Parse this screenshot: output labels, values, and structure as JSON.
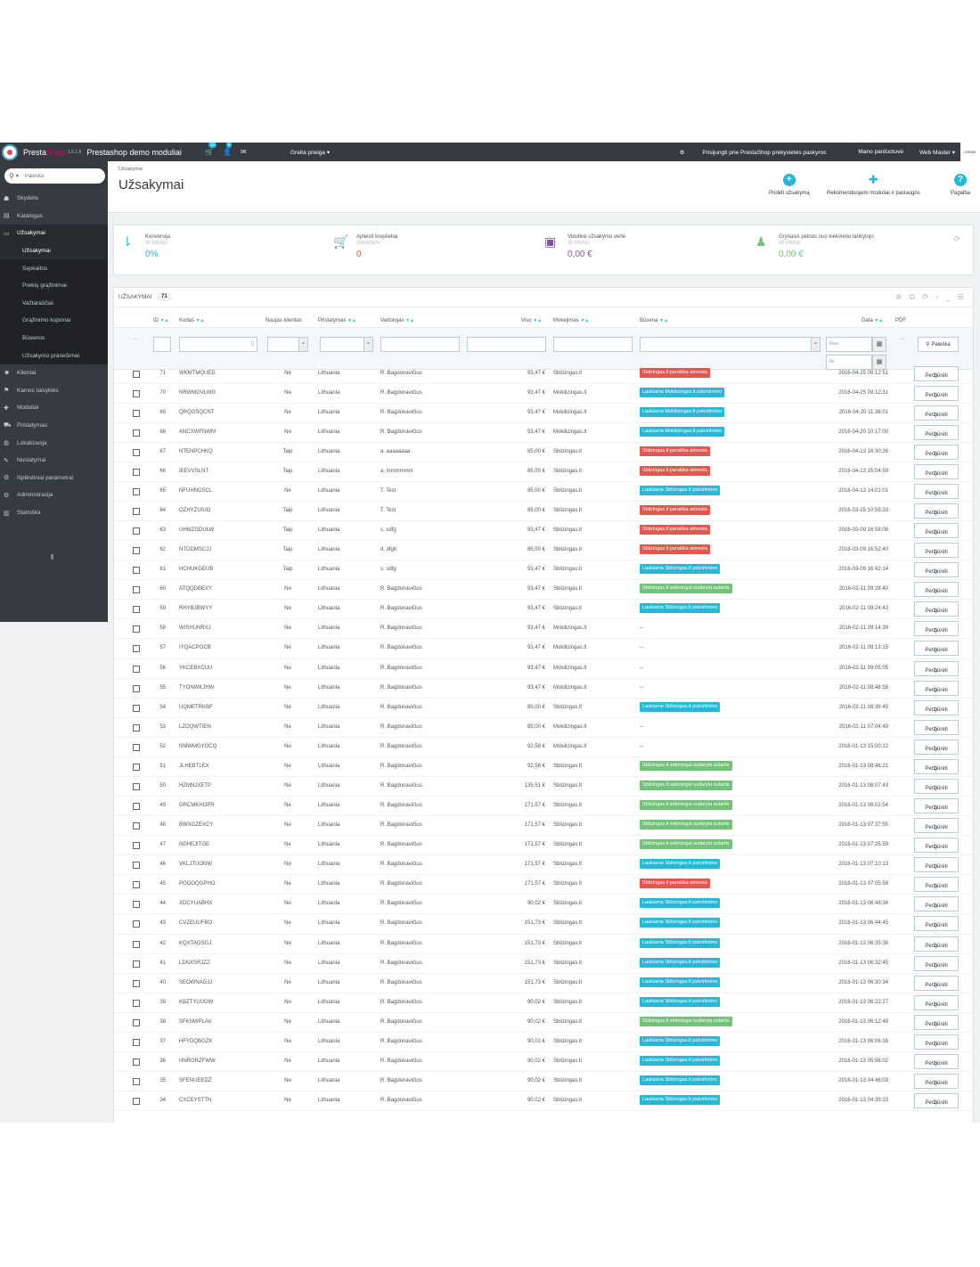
{
  "header": {
    "brand_a": "Presta",
    "brand_b": "Shop",
    "version": "1.6.1.5",
    "shop_name": "Prestashop demo moduliai",
    "orders_badge": "15",
    "customers_badge": "6",
    "quick_access": "Greita prieiga ▾",
    "connect": "Prisijungti prie PrestaShop prekyvietės paskyros",
    "my_shop": "Mano parduotuvė",
    "user": "Web Master ▾",
    "mini_logo": "CRMW"
  },
  "sidebar": {
    "search_placeholder": "Paieška",
    "items": [
      {
        "icon": "dashboard-icon",
        "glyph": "☗",
        "label": "Skydelis"
      },
      {
        "icon": "catalog-icon",
        "glyph": "▤",
        "label": "Katalogas"
      },
      {
        "icon": "orders-icon",
        "glyph": "▭",
        "label": "Užsakymai"
      },
      {
        "icon": "customers-icon",
        "glyph": "☻",
        "label": "Klientai"
      },
      {
        "icon": "price-rules-icon",
        "glyph": "⚑",
        "label": "Kainos taisyklės"
      },
      {
        "icon": "modules-icon",
        "glyph": "✚",
        "label": "Moduliai"
      },
      {
        "icon": "shipping-icon",
        "glyph": "⛟",
        "label": "Pristatymas"
      },
      {
        "icon": "localization-icon",
        "glyph": "◍",
        "label": "Lokalizacija"
      },
      {
        "icon": "settings-icon",
        "glyph": "✎",
        "label": "Nustatymai"
      },
      {
        "icon": "advanced-icon",
        "glyph": "⚙",
        "label": "Išplėstiniai parametrai"
      },
      {
        "icon": "admin-icon",
        "glyph": "⚙",
        "label": "Administracija"
      },
      {
        "icon": "stats-icon",
        "glyph": "▥",
        "label": "Statistika"
      }
    ],
    "subitems": [
      "Užsakymai",
      "Sąskaitos",
      "Prekių grąžinimai",
      "Važtaraščiai",
      "Grąžinimo kuponai",
      "Būsenos",
      "Užsakymo pranešimai"
    ]
  },
  "page": {
    "breadcrumb": "Užsakymai",
    "title": "Užsakymai",
    "tools": [
      {
        "label": "Pridėti užsakymą",
        "glyph": "+"
      },
      {
        "label": "Rekomenduojami moduliai ir paslaugos",
        "glyph": "✚"
      },
      {
        "label": "Pagalba",
        "glyph": "?"
      }
    ]
  },
  "kpis": [
    {
      "label": "Konversija",
      "sub": "30 DIENŲ",
      "value": "0%",
      "color": "#25b9d7",
      "glyph": "⇂"
    },
    {
      "label": "Apleisti krepšeliai",
      "sub": "ŠIANDIEN",
      "value": "0",
      "color": "#e0584f",
      "glyph": "🛒"
    },
    {
      "label": "Vidutinė užsakymo vertė",
      "sub": "30 DIENŲ",
      "value": "0,00 €",
      "color": "#7e55a3",
      "glyph": "▣"
    },
    {
      "label": "Grynasis pelnas nuo kiekvieno lankytojo",
      "sub": "30 DIENŲ",
      "value": "0,00 €",
      "color": "#72c279",
      "glyph": "♟"
    }
  ],
  "orders": {
    "title": "UŽSAKYMAI",
    "count": "71",
    "columns": {
      "id": "ID",
      "ref": "Kodas",
      "new": "Naujas klientas",
      "delivery": "Pristatymas",
      "customer": "Vartotojas",
      "total": "Viso",
      "payment": "Mokėjimas",
      "status": "Būsena",
      "date": "Data",
      "pdf": "PDF"
    },
    "filter": {
      "select_placeholder": "-",
      "date_from": "Nuo",
      "date_to": "Iki",
      "search_label": "Paieška"
    },
    "view_label": "Peržiūrėti",
    "rows": [
      {
        "id": "71",
        "ref": "WKMTMQUED",
        "new": "Ne",
        "delivery": "Lithuania",
        "customer": "R. Bagdonavičius",
        "total": "93,47 €",
        "payment": "Sblizingas.lt",
        "status": "Sblizingas.lt paraiška atmesta",
        "status_color": "#e0584f",
        "date": "2016-04-25 09:12:51"
      },
      {
        "id": "70",
        "ref": "NRWMGVLWG",
        "new": "Ne",
        "delivery": "Lithuania",
        "customer": "R. Bagdonavičius",
        "total": "93,47 €",
        "payment": "Mokilizingas.lt",
        "status": "Laukiama Mokilizingas.lt patvirtinimo",
        "status_color": "#25b9d7",
        "date": "2016-04-25 09:12:31"
      },
      {
        "id": "69",
        "ref": "QRQGSQCNT",
        "new": "Ne",
        "delivery": "Lithuania",
        "customer": "R. Bagdonavičius",
        "total": "93,47 €",
        "payment": "Mokilizingas.lt",
        "status": "Laukiama Mokilizingas.lt patvirtinimo",
        "status_color": "#25b9d7",
        "date": "2016-04-20 11:36:01"
      },
      {
        "id": "68",
        "ref": "ANCXWFNWM",
        "new": "Ne",
        "delivery": "Lithuania",
        "customer": "R. Bagdonavičius",
        "total": "93,47 €",
        "payment": "Mokilizingas.lt",
        "status": "Laukiama Mokilizingas.lt patvirtinimo",
        "status_color": "#25b9d7",
        "date": "2016-04-20 10:17:00"
      },
      {
        "id": "67",
        "ref": "NTENPCHKQ",
        "new": "Taip",
        "delivery": "Lithuania",
        "customer": "a. aaaaaaaa",
        "total": "85,00 €",
        "payment": "Sblizingas.lt",
        "status": "Sblizingas.lt paraiška atmesta",
        "status_color": "#e0584f",
        "date": "2016-04-13 16:30:26"
      },
      {
        "id": "66",
        "ref": "IEEVVSLNT",
        "new": "Taip",
        "delivery": "Lithuania",
        "customer": "a. mmmmmm",
        "total": "85,00 €",
        "payment": "Sblizingas.lt",
        "status": "Sblizingas.lt paraiška atmesta",
        "status_color": "#e0584f",
        "date": "2016-04-13 15:04:59"
      },
      {
        "id": "65",
        "ref": "NFUHNGSCL",
        "new": "Ne",
        "delivery": "Lithuania",
        "customer": "T. Test",
        "total": "85,00 €",
        "payment": "Sblizingas.lt",
        "status": "Laukiama Sblizingas.lt patvirtinimo",
        "status_color": "#25b9d7",
        "date": "2016-04-13 14:01:01"
      },
      {
        "id": "64",
        "ref": "OZHYZUIUO",
        "new": "Taip",
        "delivery": "Lithuania",
        "customer": "T. Test",
        "total": "85,00 €",
        "payment": "Sblizingas.lt",
        "status": "Sblizingas.lt paraiška atmesta",
        "status_color": "#e0584f",
        "date": "2016-03-25 10:59:33"
      },
      {
        "id": "63",
        "ref": "UHMZGDULW",
        "new": "Taip",
        "delivery": "Lithuania",
        "customer": "s. sdfg",
        "total": "93,47 €",
        "payment": "Sblizingas.lt",
        "status": "Sblizingas.lt paraiška atmesta",
        "status_color": "#e0584f",
        "date": "2016-03-09 16:58:08"
      },
      {
        "id": "62",
        "ref": "NTODMSCJJ",
        "new": "Taip",
        "delivery": "Lithuania",
        "customer": "d. dfgh",
        "total": "85,00 €",
        "payment": "Sblizingas.lt",
        "status": "Sblizingas.lt paraiška atmesta",
        "status_color": "#e0584f",
        "date": "2016-03-09 16:52:40"
      },
      {
        "id": "61",
        "ref": "HCHUKGEUB",
        "new": "Taip",
        "delivery": "Lithuania",
        "customer": "s. sdfg",
        "total": "93,47 €",
        "payment": "Sblizingas.lt",
        "status": "Laukiama Sblizingas.lt patvirtinimo",
        "status_color": "#25b9d7",
        "date": "2016-03-09 16:42:14"
      },
      {
        "id": "60",
        "ref": "ATQQDBEXY",
        "new": "Ne",
        "delivery": "Lithuania",
        "customer": "R. Bagdonavičius",
        "total": "93,47 €",
        "payment": "Sblizingas.lt",
        "status": "Sblizingas.lt sėkmingai sudaryta sutartis",
        "status_color": "#72c279",
        "date": "2016-02-11 09:28:40"
      },
      {
        "id": "59",
        "ref": "RHYBJBWYY",
        "new": "Ne",
        "delivery": "Lithuania",
        "customer": "R. Bagdonavičius",
        "total": "93,47 €",
        "payment": "Sblizingas.lt",
        "status": "Laukiama Sblizingas.lt patvirtinimo",
        "status_color": "#25b9d7",
        "date": "2016-02-11 09:24:43"
      },
      {
        "id": "58",
        "ref": "WISHUNRXJ",
        "new": "Ne",
        "delivery": "Lithuania",
        "customer": "R. Bagdonavičius",
        "total": "93,47 €",
        "payment": "Mokilizingas.lt",
        "status": "--",
        "status_color": "",
        "date": "2016-02-11 09:14:39"
      },
      {
        "id": "57",
        "ref": "IYQACPGCB",
        "new": "Ne",
        "delivery": "Lithuania",
        "customer": "R. Bagdonavičius",
        "total": "93,47 €",
        "payment": "Mokilizingas.lt",
        "status": "--",
        "status_color": "",
        "date": "2016-02-11 09:13:15"
      },
      {
        "id": "56",
        "ref": "YKCEBXCUU",
        "new": "Ne",
        "delivery": "Lithuania",
        "customer": "R. Bagdonavičius",
        "total": "93,47 €",
        "payment": "Mokilizingas.lt",
        "status": "--",
        "status_color": "",
        "date": "2016-02-11 09:05:05"
      },
      {
        "id": "55",
        "ref": "TYONWKJHW",
        "new": "Ne",
        "delivery": "Lithuania",
        "customer": "R. Bagdonavičius",
        "total": "93,47 €",
        "payment": "Mokilizingas.lt",
        "status": "--",
        "status_color": "",
        "date": "2016-02-11 08:48:58"
      },
      {
        "id": "54",
        "ref": "UQMETRKBF",
        "new": "Ne",
        "delivery": "Lithuania",
        "customer": "R. Bagdonavičius",
        "total": "85,00 €",
        "payment": "Sblizingas.lt",
        "status": "Laukiama Sblizingas.lt patvirtinimo",
        "status_color": "#25b9d7",
        "date": "2016-02-11 08:39:45"
      },
      {
        "id": "53",
        "ref": "LZOQWTIEN",
        "new": "Ne",
        "delivery": "Lithuania",
        "customer": "R. Bagdonavičius",
        "total": "85,00 €",
        "payment": "Mokilizingas.lt",
        "status": "--",
        "status_color": "",
        "date": "2016-02-11 07:04:49"
      },
      {
        "id": "52",
        "ref": "NMWMGYOCQ",
        "new": "Ne",
        "delivery": "Lithuania",
        "customer": "R. Bagdonavičius",
        "total": "92,58 €",
        "payment": "Mokilizingas.lt",
        "status": "--",
        "status_color": "",
        "date": "2016-01-13 15:00:22"
      },
      {
        "id": "51",
        "ref": "JLHEBTLEX",
        "new": "Ne",
        "delivery": "Lithuania",
        "customer": "R. Bagdonavičius",
        "total": "92,58 €",
        "payment": "Sblizingas.lt",
        "status": "Sblizingas.lt sėkmingai sudaryta sutartis",
        "status_color": "#72c279",
        "date": "2016-01-13 08:46:21"
      },
      {
        "id": "50",
        "ref": "HZMNJXETP",
        "new": "Ne",
        "delivery": "Lithuania",
        "customer": "R. Bagdonavičius",
        "total": "135,51 €",
        "payment": "Sblizingas.lt",
        "status": "Sblizingas.lt sėkmingai sudaryta sutartis",
        "status_color": "#72c279",
        "date": "2016-01-13 08:07:43"
      },
      {
        "id": "49",
        "ref": "GRCMKHOPR",
        "new": "Ne",
        "delivery": "Lithuania",
        "customer": "R. Bagdonavičius",
        "total": "171,57 €",
        "payment": "Sblizingas.lt",
        "status": "Sblizingas.lt sėkmingai sudaryta sutartis",
        "status_color": "#72c279",
        "date": "2016-01-13 08:02:54"
      },
      {
        "id": "48",
        "ref": "BWXGZEXCY",
        "new": "Ne",
        "delivery": "Lithuania",
        "customer": "R. Bagdonavičius",
        "total": "171,57 €",
        "payment": "Sblizingas.lt",
        "status": "Sblizingas.lt sėkmingai sudaryta sutartis",
        "status_color": "#72c279",
        "date": "2016-01-13 07:37:55"
      },
      {
        "id": "47",
        "ref": "NDHEJITGE",
        "new": "Ne",
        "delivery": "Lithuania",
        "customer": "R. Bagdonavičius",
        "total": "171,57 €",
        "payment": "Sblizingas.lt",
        "status": "Sblizingas.lt sėkmingai sudaryta sutartis",
        "status_color": "#72c279",
        "date": "2016-01-13 07:25:59"
      },
      {
        "id": "46",
        "ref": "VKLJTUONW",
        "new": "Ne",
        "delivery": "Lithuania",
        "customer": "R. Bagdonavičius",
        "total": "171,57 €",
        "payment": "Sblizingas.lt",
        "status": "Laukiama Sblizingas.lt patvirtinimo",
        "status_color": "#25b9d7",
        "date": "2016-01-13 07:10:13"
      },
      {
        "id": "45",
        "ref": "PGOOQGPHO",
        "new": "Ne",
        "delivery": "Lithuania",
        "customer": "R. Bagdonavičius",
        "total": "171,57 €",
        "payment": "Sblizingas.lt",
        "status": "Sblizingas.lt paraiška atmesta",
        "status_color": "#e0584f",
        "date": "2016-01-13 07:05:58"
      },
      {
        "id": "44",
        "ref": "XDCYUABHX",
        "new": "Ne",
        "delivery": "Lithuania",
        "customer": "R. Bagdonavičius",
        "total": "90,02 €",
        "payment": "Sblizingas.lt",
        "status": "Laukiama Sblizingas.lt patvirtinimo",
        "status_color": "#25b9d7",
        "date": "2016-01-13 06:48:34"
      },
      {
        "id": "43",
        "ref": "CVZEUUFBO",
        "new": "Ne",
        "delivery": "Lithuania",
        "customer": "R. Bagdonavičius",
        "total": "151,73 €",
        "payment": "Sblizingas.lt",
        "status": "Laukiama Sblizingas.lt patvirtinimo",
        "status_color": "#25b9d7",
        "date": "2016-01-13 06:44:45"
      },
      {
        "id": "42",
        "ref": "KQXTAGSGJ",
        "new": "Ne",
        "delivery": "Lithuania",
        "customer": "R. Bagdonavičius",
        "total": "151,73 €",
        "payment": "Sblizingas.lt",
        "status": "Laukiama Sblizingas.lt patvirtinimo",
        "status_color": "#25b9d7",
        "date": "2016-01-13 06:35:38"
      },
      {
        "id": "41",
        "ref": "LDNXSRJZZ",
        "new": "Ne",
        "delivery": "Lithuania",
        "customer": "R. Bagdonavičius",
        "total": "151,73 €",
        "payment": "Sblizingas.lt",
        "status": "Laukiama Sblizingas.lt patvirtinimo",
        "status_color": "#25b9d7",
        "date": "2016-01-13 06:32:45"
      },
      {
        "id": "40",
        "ref": "SEOWNAGJJ",
        "new": "Ne",
        "delivery": "Lithuania",
        "customer": "R. Bagdonavičius",
        "total": "151,73 €",
        "payment": "Sblizingas.lt",
        "status": "Laukiama Sblizingas.lt patvirtinimo",
        "status_color": "#25b9d7",
        "date": "2016-01-13 06:30:34"
      },
      {
        "id": "39",
        "ref": "KBZTYUUGW",
        "new": "Ne",
        "delivery": "Lithuania",
        "customer": "R. Bagdonavičius",
        "total": "90,02 €",
        "payment": "Sblizingas.lt",
        "status": "Laukiama Sblizingas.lt patvirtinimo",
        "status_color": "#25b9d7",
        "date": "2016-01-13 06:22:27"
      },
      {
        "id": "38",
        "ref": "SFKNWPLAV",
        "new": "Ne",
        "delivery": "Lithuania",
        "customer": "R. Bagdonavičius",
        "total": "90,02 €",
        "payment": "Sblizingas.lt",
        "status": "Sblizingas.lt sėkmingai sudaryta sutartis",
        "status_color": "#72c279",
        "date": "2016-01-13 06:12:49"
      },
      {
        "id": "37",
        "ref": "HFYDQBGZK",
        "new": "Ne",
        "delivery": "Lithuania",
        "customer": "R. Bagdonavičius",
        "total": "90,02 €",
        "payment": "Sblizingas.lt",
        "status": "Laukiama Sblizingas.lt patvirtinimo",
        "status_color": "#25b9d7",
        "date": "2016-01-13 06:06:18"
      },
      {
        "id": "36",
        "ref": "HNRGRZFWW",
        "new": "Ne",
        "delivery": "Lithuania",
        "customer": "R. Bagdonavičius",
        "total": "90,02 €",
        "payment": "Sblizingas.lt",
        "status": "Laukiama Sblizingas.lt patvirtinimo",
        "status_color": "#25b9d7",
        "date": "2016-01-13 05:56:02"
      },
      {
        "id": "35",
        "ref": "SFENUEEDZ",
        "new": "Ne",
        "delivery": "Lithuania",
        "customer": "R. Bagdonavičius",
        "total": "90,02 €",
        "payment": "Sblizingas.lt",
        "status": "Laukiama Sblizingas.lt patvirtinimo",
        "status_color": "#25b9d7",
        "date": "2016-01-13 04:46:03"
      },
      {
        "id": "34",
        "ref": "CXCEYSTTN",
        "new": "Ne",
        "delivery": "Lithuania",
        "customer": "R. Bagdonavičius",
        "total": "90,02 €",
        "payment": "Sblizingas.lt",
        "status": "Laukiama Sblizingas.lt patvirtinimo",
        "status_color": "#25b9d7",
        "date": "2016-01-13 04:39:23"
      }
    ]
  }
}
